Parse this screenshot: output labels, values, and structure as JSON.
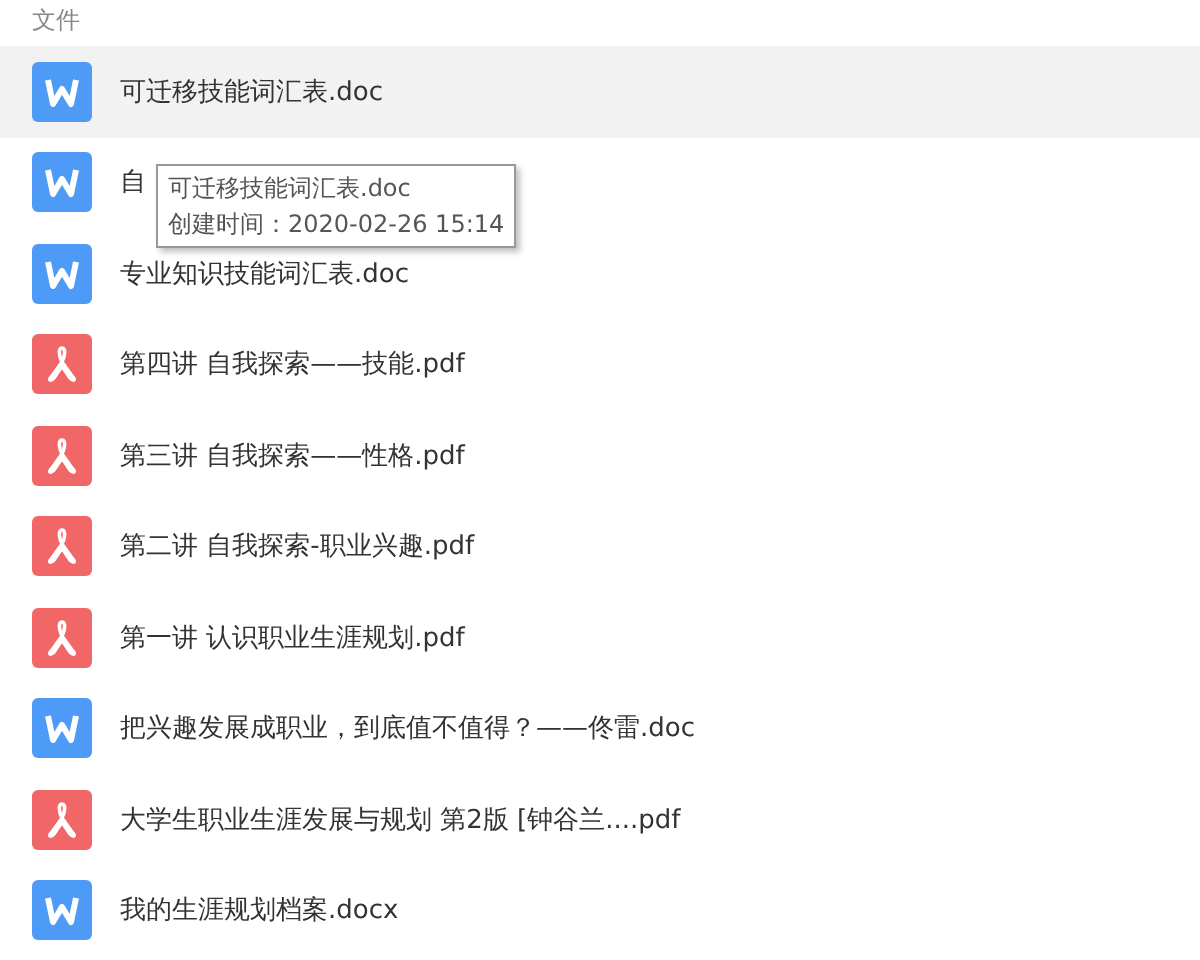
{
  "section_title": "文件",
  "files": [
    {
      "kind": "doc",
      "name": "可迁移技能词汇表.doc",
      "selected": true
    },
    {
      "kind": "doc",
      "name": "自",
      "selected": false
    },
    {
      "kind": "doc",
      "name": "专业知识技能词汇表.doc",
      "selected": false
    },
    {
      "kind": "pdf",
      "name": "第四讲 自我探索——技能.pdf",
      "selected": false
    },
    {
      "kind": "pdf",
      "name": "第三讲 自我探索——性格.pdf",
      "selected": false
    },
    {
      "kind": "pdf",
      "name": "第二讲 自我探索-职业兴趣.pdf",
      "selected": false
    },
    {
      "kind": "pdf",
      "name": "第一讲 认识职业生涯规划.pdf",
      "selected": false
    },
    {
      "kind": "doc",
      "name": "把兴趣发展成职业，到底值不值得？——佟雷.doc",
      "selected": false
    },
    {
      "kind": "pdf",
      "name": "大学生职业生涯发展与规划  第2版 [钟谷兰....pdf",
      "selected": false
    },
    {
      "kind": "doc",
      "name": "我的生涯规划档案.docx",
      "selected": false
    }
  ],
  "tooltip": {
    "title": "可迁移技能词汇表.doc",
    "created": "创建时间：2020-02-26 15:14"
  }
}
